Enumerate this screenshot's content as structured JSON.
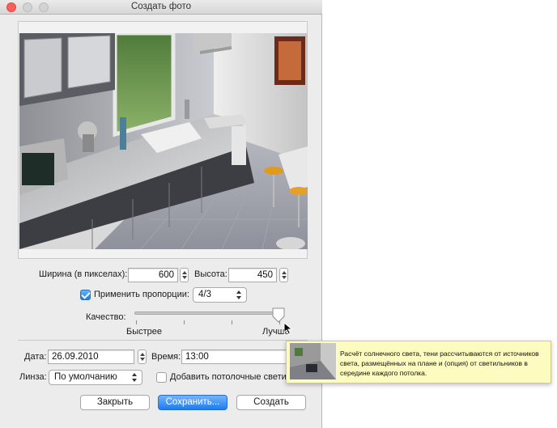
{
  "window": {
    "title": "Создать фото"
  },
  "preview": {
    "image_description_icon": "kitchen-render-image"
  },
  "size": {
    "width_label": "Ширина (в пикселах):",
    "width_value": "600",
    "height_label": "Высота:",
    "height_value": "450"
  },
  "proportions": {
    "label": "Применить пропорции:",
    "checked": true,
    "selected": "4/3"
  },
  "quality": {
    "label": "Качество:",
    "min_label": "Быстрее",
    "max_label": "Лучше",
    "level": 1.0
  },
  "date": {
    "label": "Дата:",
    "value": "26.09.2010"
  },
  "time": {
    "label": "Время:",
    "value": "13:00"
  },
  "lens": {
    "label": "Линза:",
    "selected": "По умолчанию"
  },
  "ceiling_lights": {
    "label": "Добавить потолочные светильники",
    "checked": false
  },
  "buttons": {
    "close": "Закрыть",
    "save": "Сохранить...",
    "create": "Создать"
  },
  "tooltip": {
    "text": "Расчёт солнечного света, тени рассчитываются от источников света, размещённых на плане и (опция) от светильников в середине каждого потолка."
  },
  "colors": {
    "accent": "#1b7cf1",
    "tooltip_bg": "#fdfbc0",
    "close_light": "#fc605b"
  }
}
